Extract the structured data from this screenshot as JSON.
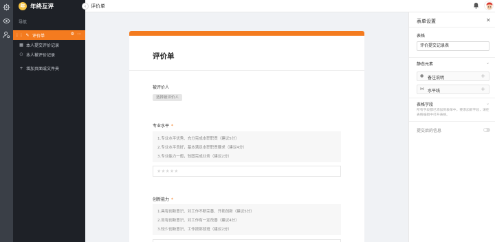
{
  "app": {
    "brand": "年终互评",
    "logo_letter": "年"
  },
  "colors": {
    "accent": "#f47b1f",
    "nav_bg": "#1e2127",
    "rail_bg": "#3a3f47"
  },
  "rail": {
    "icons": [
      "gear-icon",
      "eye-icon",
      "user-settings-icon"
    ]
  },
  "nav": {
    "section_label": "导航",
    "items": [
      {
        "label": "评价单",
        "icon": "edit-icon"
      },
      {
        "label": "本人提交评价记录",
        "icon": "table-icon"
      },
      {
        "label": "本人被评价记录",
        "icon": "person-icon"
      },
      {
        "label": "增加页面或文件夹",
        "icon": "plus-icon"
      }
    ]
  },
  "topbar": {
    "title": "评价单"
  },
  "form": {
    "title": "评价单",
    "evaluatee": {
      "label": "被评价人",
      "tag": "选择被评价人"
    },
    "questions": [
      {
        "label": "专业水平",
        "required_mark": "*",
        "options": [
          "1.专业水平优秀、充分完成本职职责（建议5分）",
          "2.专业水平良好，基本满足本职职责要求（建议4分）",
          "3.专业能力一般，较固完成业务（建议2分）"
        ],
        "stars": "★★★★★"
      },
      {
        "label": "创新能力",
        "required_mark": "*",
        "options": [
          "1.具有创新意识、对工作不断完善、开拓创新（建议5分）",
          "2.尚有创新意识、对工作有一定改善（建议4分）",
          "3.较少创新意识、工作按部就班（建议2分）"
        ],
        "stars": "★★★★★"
      }
    ]
  },
  "settings": {
    "title": "表单设置",
    "table_label": "表格",
    "table_value": "评价提交记录表",
    "static_label": "静态元素",
    "static_items": [
      {
        "label": "备注说明",
        "icon": "info-icon"
      },
      {
        "label": "水平线",
        "icon": "horizontal-line-icon"
      }
    ],
    "fields_label": "表格字段",
    "fields_help": "所有字段都已添加到表单中。要添加新字段，请在表格编辑中打开表格。",
    "after_submit_label": "提交后的信息"
  }
}
